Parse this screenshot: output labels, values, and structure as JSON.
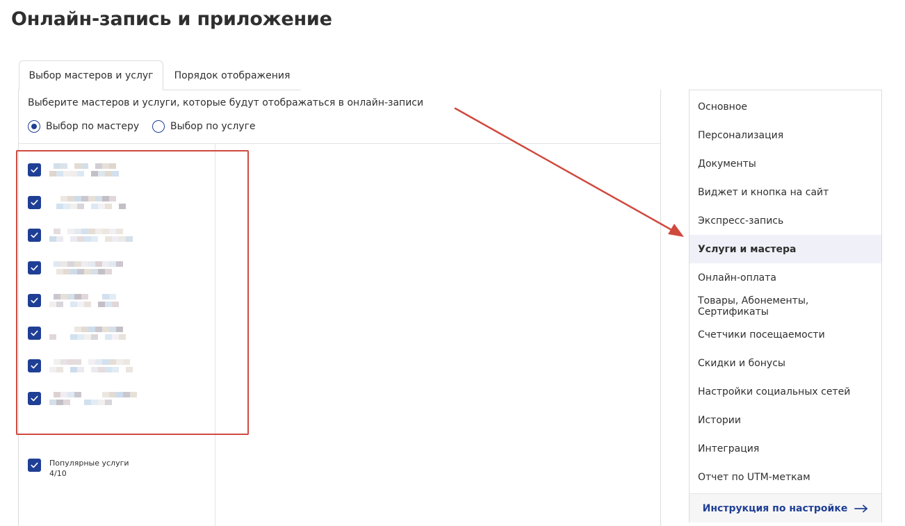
{
  "page": {
    "title": "Онлайн-запись и приложение"
  },
  "tabs": [
    {
      "label": "Выбор мастеров и услуг",
      "active": true
    },
    {
      "label": "Порядок отображения",
      "active": false
    }
  ],
  "panel": {
    "hint": "Выберите мастеров и услуги, которые будут отображаться в онлайн-записи",
    "radios": [
      {
        "label": "Выбор по мастеру",
        "checked": true
      },
      {
        "label": "Выбор по услуге",
        "checked": false
      }
    ],
    "masters_checked": [
      true,
      true,
      true,
      true,
      true,
      true,
      true,
      true
    ],
    "popular": {
      "label": "Популярные услуги",
      "count": "4/10",
      "checked": true
    }
  },
  "side_menu": {
    "items": [
      {
        "label": "Основное"
      },
      {
        "label": "Персонализация"
      },
      {
        "label": "Документы"
      },
      {
        "label": "Виджет и кнопка на сайт"
      },
      {
        "label": "Экспресс-запись"
      },
      {
        "label": "Услуги и мастера",
        "active": true
      },
      {
        "label": "Онлайн-оплата"
      },
      {
        "label": "Товары, Абонементы, Сертификаты"
      },
      {
        "label": "Счетчики посещаемости"
      },
      {
        "label": "Скидки и бонусы"
      },
      {
        "label": "Настройки социальных сетей"
      },
      {
        "label": "Истории"
      },
      {
        "label": "Интеграция"
      },
      {
        "label": "Отчет по UTM-меткам"
      }
    ],
    "footer_link": "Инструкция по настройке"
  },
  "colors": {
    "accent": "#1f3f95",
    "highlight": "#d0493e",
    "active_bg": "#f0f1f8"
  },
  "icons": {
    "checkbox": "checkmark-icon",
    "footer": "arrow-right-icon"
  }
}
